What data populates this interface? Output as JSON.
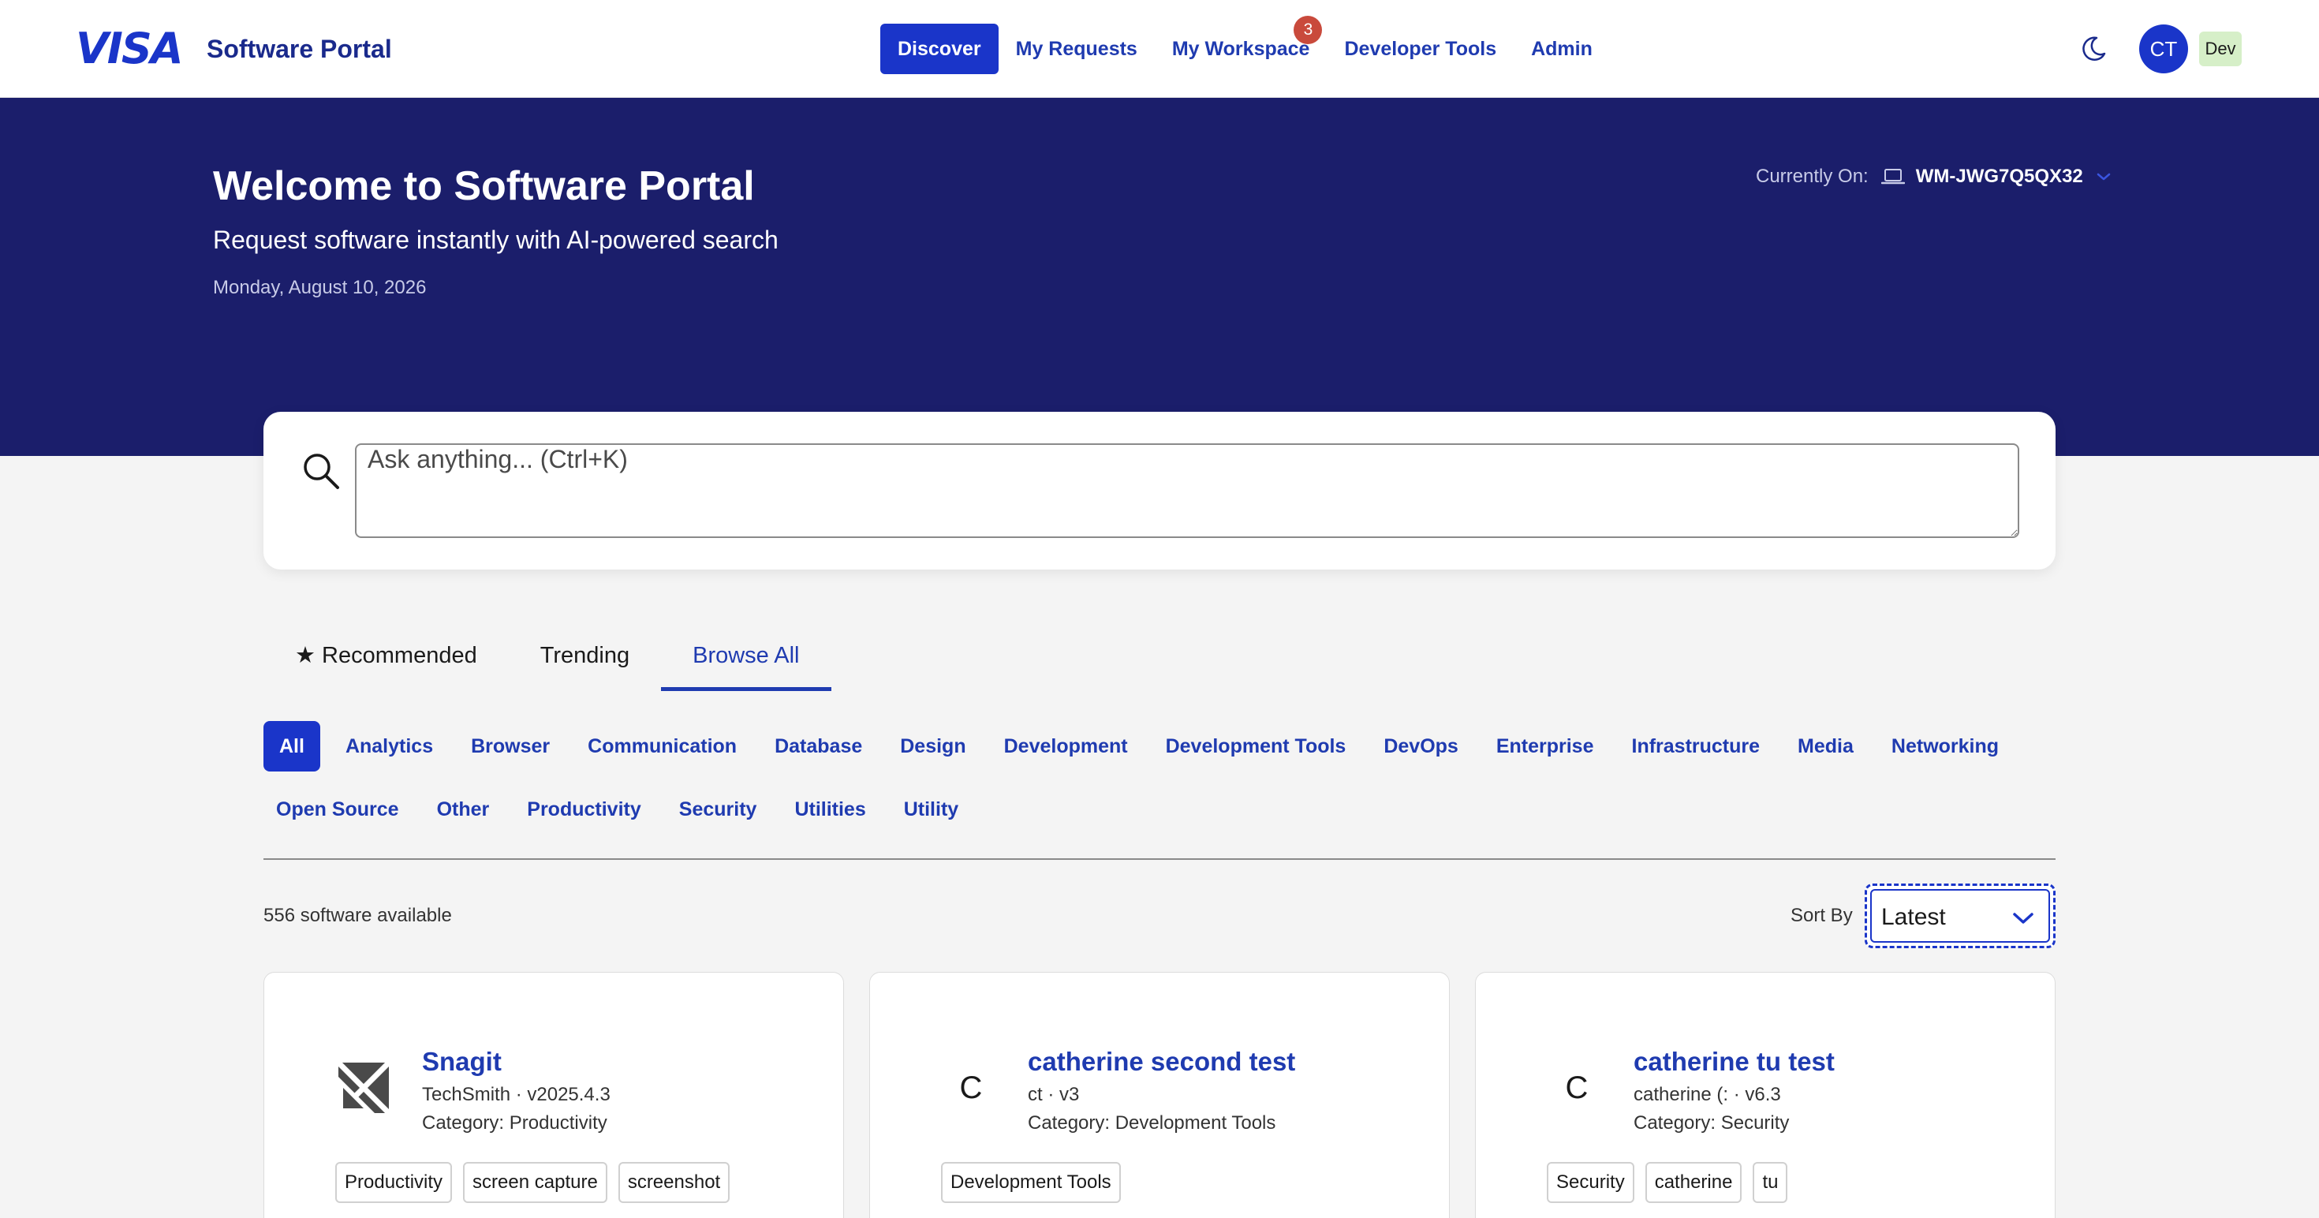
{
  "header": {
    "logo_text": "VISA",
    "portal_name": "Software Portal",
    "nav": [
      {
        "label": "Discover",
        "active": true
      },
      {
        "label": "My Requests",
        "active": false
      },
      {
        "label": "My Workspace",
        "active": false,
        "badge": "3"
      },
      {
        "label": "Developer Tools",
        "active": false
      },
      {
        "label": "Admin",
        "active": false
      }
    ],
    "avatar_initials": "CT",
    "env_badge": "Dev"
  },
  "hero": {
    "title": "Welcome to Software Portal",
    "subtitle": "Request software instantly with AI-powered search",
    "date": "Monday, August 10, 2026",
    "device_label": "Currently On:",
    "device_name": "WM-JWG7Q5QX32"
  },
  "search": {
    "placeholder": "Ask anything... (Ctrl+K)"
  },
  "tabs": [
    {
      "label": "★ Recommended",
      "active": false
    },
    {
      "label": "Trending",
      "active": false
    },
    {
      "label": "Browse All",
      "active": true
    }
  ],
  "categories": {
    "row1": [
      "All",
      "Analytics",
      "Browser",
      "Communication",
      "Database",
      "Design",
      "Development",
      "Development Tools",
      "DevOps",
      "Enterprise",
      "Infrastructure",
      "Media",
      "Networking"
    ],
    "row2": [
      "Open Source",
      "Other",
      "Productivity",
      "Security",
      "Utilities",
      "Utility"
    ]
  },
  "results": {
    "count_text": "556 software available",
    "sort_label": "Sort By",
    "sort_value": "Latest"
  },
  "cards": [
    {
      "title": "Snagit",
      "meta": "TechSmith · v2025.4.3",
      "category": "Category: Productivity",
      "tags": [
        "Productivity",
        "screen capture",
        "screenshot"
      ]
    },
    {
      "title": "catherine second test",
      "initial": "C",
      "meta": "ct · v3",
      "category": "Category: Development Tools",
      "tags": [
        "Development Tools"
      ]
    },
    {
      "title": "catherine tu test",
      "initial": "C",
      "meta": "catherine (: · v6.3",
      "category": "Category: Security",
      "tags": [
        "Security",
        "catherine",
        "tu"
      ]
    }
  ],
  "colors": {
    "brand_blue": "#1a35c9",
    "hero_navy": "#1b1e6b",
    "badge_red": "#c94a3c",
    "env_green": "#d6efc8"
  }
}
